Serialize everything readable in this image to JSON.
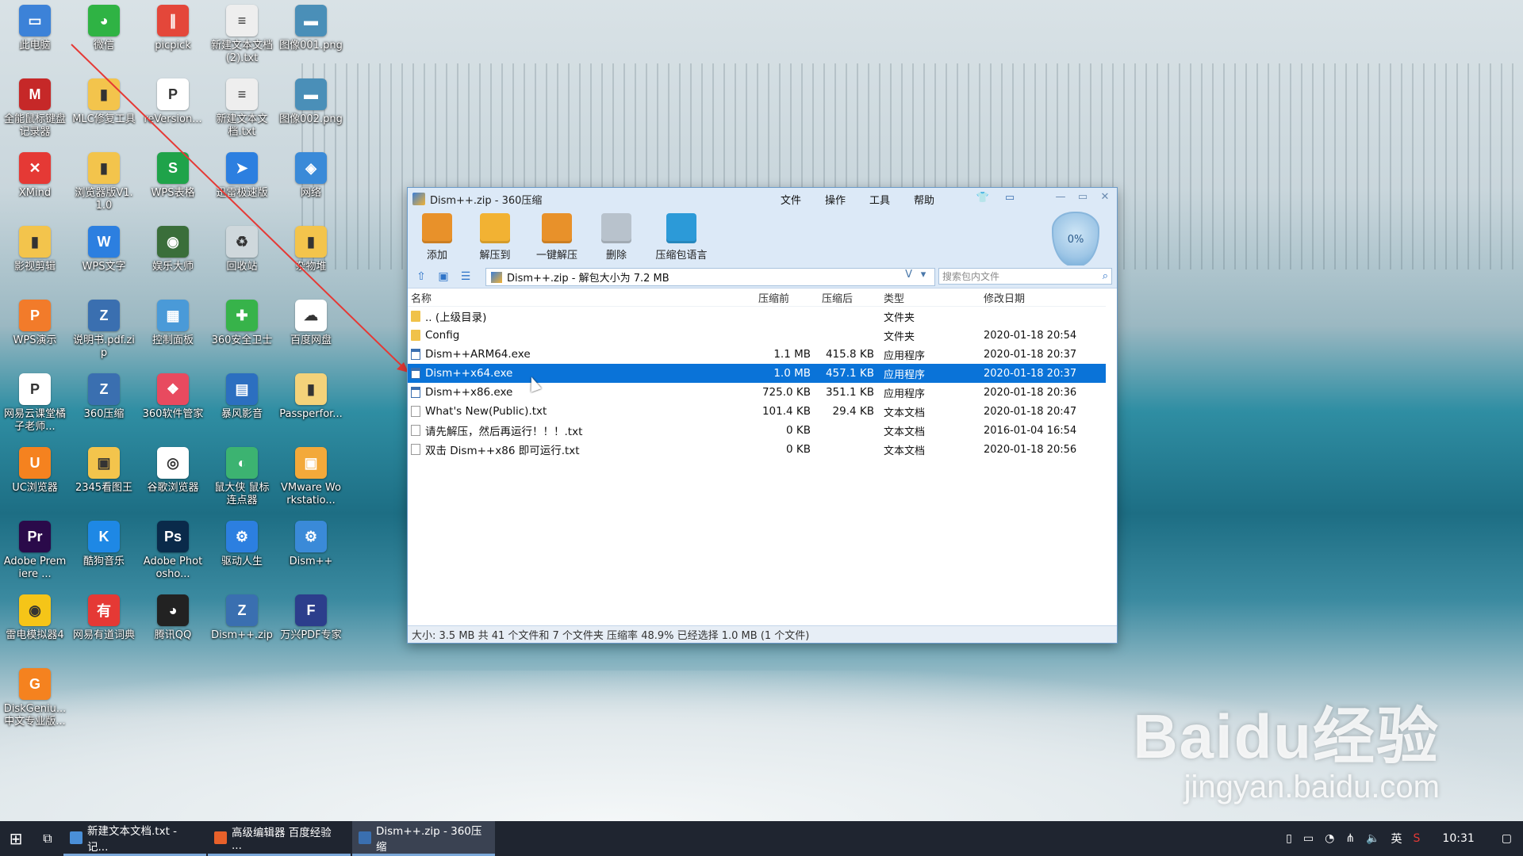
{
  "desktop": {
    "icons": [
      {
        "label": "此电脑",
        "color": "#3c82d8",
        "glyph": "▭"
      },
      {
        "label": "微信",
        "color": "#2fb344",
        "glyph": "◕"
      },
      {
        "label": "picpick",
        "color": "#e4473a",
        "glyph": "∥"
      },
      {
        "label": "新建文本文档 (2).txt",
        "color": "#eeeeee",
        "glyph": "≡"
      },
      {
        "label": "图像001.png",
        "color": "#4a8fb8",
        "glyph": "▬"
      },
      {
        "label": "全能鼠标键盘记录器",
        "color": "#c62828",
        "glyph": "M"
      },
      {
        "label": "MLC修复工具",
        "color": "#f3c44c",
        "glyph": "▮"
      },
      {
        "label": "reVersion...",
        "color": "#ffffff",
        "glyph": "P"
      },
      {
        "label": "新建文本文档.txt",
        "color": "#eeeeee",
        "glyph": "≡"
      },
      {
        "label": "图像002.png",
        "color": "#4a8fb8",
        "glyph": "▬"
      },
      {
        "label": "XMind",
        "color": "#e53935",
        "glyph": "✕"
      },
      {
        "label": "浏览器版V1.1.0",
        "color": "#f3c44c",
        "glyph": "▮"
      },
      {
        "label": "WPS表格",
        "color": "#1fa34a",
        "glyph": "S"
      },
      {
        "label": "迅雷极速版",
        "color": "#2c7fe0",
        "glyph": "➤"
      },
      {
        "label": "网络",
        "color": "#3a8ad8",
        "glyph": "◈"
      },
      {
        "label": "影视剪辑",
        "color": "#f3c44c",
        "glyph": "▮"
      },
      {
        "label": "WPS文字",
        "color": "#2c7fe0",
        "glyph": "W"
      },
      {
        "label": "娱乐大师",
        "color": "#3a6e3a",
        "glyph": "◉"
      },
      {
        "label": "回收站",
        "color": "#cfd8dc",
        "glyph": "♻"
      },
      {
        "label": "杂物堆",
        "color": "#f3c44c",
        "glyph": "▮"
      },
      {
        "label": "WPS演示",
        "color": "#f27b2a",
        "glyph": "P"
      },
      {
        "label": "说明书.pdf.zip",
        "color": "#3a6fb0",
        "glyph": "Z"
      },
      {
        "label": "控制面板",
        "color": "#4a9ad8",
        "glyph": "▦"
      },
      {
        "label": "360安全卫士",
        "color": "#37b34a",
        "glyph": "✚"
      },
      {
        "label": "百度网盘",
        "color": "#ffffff",
        "glyph": "☁"
      },
      {
        "label": "网易云课堂橘子老师...",
        "color": "#ffffff",
        "glyph": "P"
      },
      {
        "label": "360压缩",
        "color": "#3a6fb0",
        "glyph": "Z"
      },
      {
        "label": "360软件管家",
        "color": "#e84a5f",
        "glyph": "❖"
      },
      {
        "label": "暴风影音",
        "color": "#2c6fc0",
        "glyph": "▤"
      },
      {
        "label": "Passperfor...",
        "color": "#f3d27a",
        "glyph": "▮"
      },
      {
        "label": "UC浏览器",
        "color": "#f5821f",
        "glyph": "U"
      },
      {
        "label": "2345看图王",
        "color": "#f3c44c",
        "glyph": "▣"
      },
      {
        "label": "谷歌浏览器",
        "color": "#ffffff",
        "glyph": "◎"
      },
      {
        "label": "鼠大侠 鼠标连点器",
        "color": "#3cb371",
        "glyph": "◐"
      },
      {
        "label": "VMware Workstatio...",
        "color": "#f3a93a",
        "glyph": "▣"
      },
      {
        "label": "Adobe Premiere ...",
        "color": "#2a0a4a",
        "glyph": "Pr"
      },
      {
        "label": "酷狗音乐",
        "color": "#1e88e5",
        "glyph": "K"
      },
      {
        "label": "Adobe Photosho...",
        "color": "#0a2a4a",
        "glyph": "Ps"
      },
      {
        "label": "驱动人生",
        "color": "#2c7fe0",
        "glyph": "⚙"
      },
      {
        "label": "Dism++",
        "color": "#3a8ad8",
        "glyph": "⚙"
      },
      {
        "label": "雷电模拟器4",
        "color": "#f5c518",
        "glyph": "◉"
      },
      {
        "label": "网易有道词典",
        "color": "#e53935",
        "glyph": "有"
      },
      {
        "label": "腾讯QQ",
        "color": "#222222",
        "glyph": "◕"
      },
      {
        "label": "Dism++.zip",
        "color": "#3a6fb0",
        "glyph": "Z"
      },
      {
        "label": "万兴PDF专家",
        "color": "#2c3e8c",
        "glyph": "F"
      },
      {
        "label": "DiskGeniu... 中文专业版...",
        "color": "#f5821f",
        "glyph": "G"
      }
    ]
  },
  "window": {
    "title": "Dism++.zip - 360压缩",
    "menu": [
      "文件",
      "操作",
      "工具",
      "帮助"
    ],
    "toolbar": [
      {
        "label": "添加",
        "color": "#e8912a"
      },
      {
        "label": "解压到",
        "color": "#f2b233"
      },
      {
        "label": "一键解压",
        "color": "#e8912a"
      },
      {
        "label": "删除",
        "color": "#b8c2cc"
      },
      {
        "label": "压缩包语言",
        "color": "#2c9ad8"
      }
    ],
    "shield_percent": "0%",
    "path_text": "Dism++.zip - 解包大小为 7.2 MB",
    "path_v": "V",
    "search_placeholder": "搜索包内文件",
    "columns": [
      "名称",
      "压缩前",
      "压缩后",
      "类型",
      "修改日期"
    ],
    "files": [
      {
        "name": ".. (上级目录)",
        "pre": "",
        "post": "",
        "type": "文件夹",
        "date": "",
        "kind": "folder",
        "selected": false
      },
      {
        "name": "Config",
        "pre": "",
        "post": "",
        "type": "文件夹",
        "date": "2020-01-18 20:54",
        "kind": "folder",
        "selected": false
      },
      {
        "name": "Dism++ARM64.exe",
        "pre": "1.1 MB",
        "post": "415.8 KB",
        "type": "应用程序",
        "date": "2020-01-18 20:37",
        "kind": "exe",
        "selected": false
      },
      {
        "name": "Dism++x64.exe",
        "pre": "1.0 MB",
        "post": "457.1 KB",
        "type": "应用程序",
        "date": "2020-01-18 20:37",
        "kind": "exe",
        "selected": true
      },
      {
        "name": "Dism++x86.exe",
        "pre": "725.0 KB",
        "post": "351.1 KB",
        "type": "应用程序",
        "date": "2020-01-18 20:36",
        "kind": "exe",
        "selected": false
      },
      {
        "name": "What's New(Public).txt",
        "pre": "101.4 KB",
        "post": "29.4 KB",
        "type": "文本文档",
        "date": "2020-01-18 20:47",
        "kind": "txt",
        "selected": false
      },
      {
        "name": "请先解压，然后再运行！！！.txt",
        "pre": "0 KB",
        "post": "",
        "type": "文本文档",
        "date": "2016-01-04 16:54",
        "kind": "txt",
        "selected": false
      },
      {
        "name": "双击 Dism++x86 即可运行.txt",
        "pre": "0 KB",
        "post": "",
        "type": "文本文档",
        "date": "2020-01-18 20:56",
        "kind": "txt",
        "selected": false
      }
    ],
    "status": "大小: 3.5 MB 共 41 个文件和 7 个文件夹 压缩率 48.9% 已经选择 1.0 MB (1 个文件)"
  },
  "watermark": {
    "big": "Baidu经验",
    "small": "jingyan.baidu.com"
  },
  "taskbar": {
    "tasks": [
      {
        "label": "新建文本文档.txt - 记...",
        "color": "#4a8fd8",
        "active": false
      },
      {
        "label": "高级编辑器 百度经验 ...",
        "color": "#e8612a",
        "active": false
      },
      {
        "label": "Dism++.zip - 360压缩",
        "color": "#3a6fb0",
        "active": true
      }
    ],
    "ime": "英",
    "time": "10:31"
  }
}
